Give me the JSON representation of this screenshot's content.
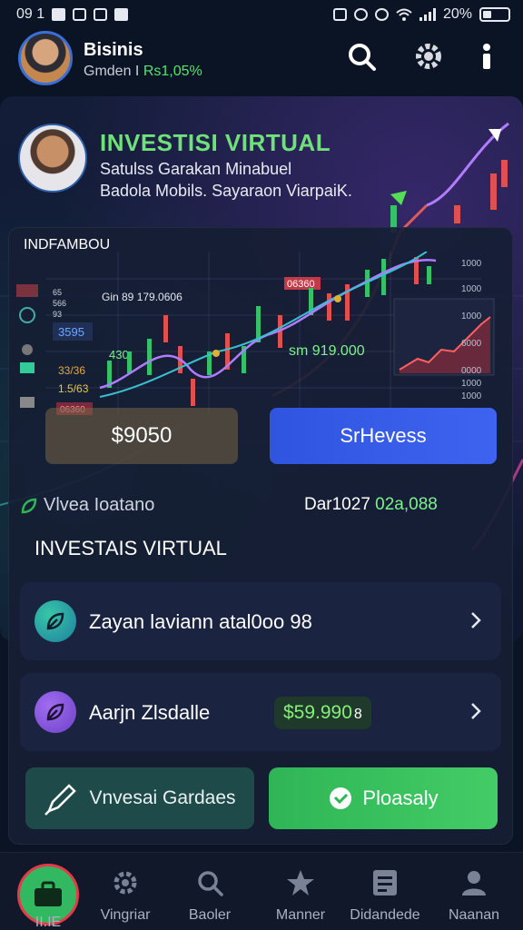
{
  "status_bar": {
    "time": "09 1",
    "battery": "20%"
  },
  "header": {
    "title": "Bisinis",
    "subtitle_prefix": "Gmden I",
    "subtitle_value": "Rs1,05%"
  },
  "hero": {
    "title": "INVESTISI VIRTUAL",
    "line1": "Satulss Garakan Minabuel",
    "line2": "Badola Mobils. Sayaraon ViarpaiK."
  },
  "panel": {
    "label": "INDFAMBOU",
    "chart_labels": {
      "price_tag": "Gin 89 179.0606",
      "value_tag": "sm 919.000",
      "high_tag": "06360",
      "side_tags": [
        "3595",
        "430",
        "33/36",
        "1.5/63",
        "06360"
      ],
      "left_codes": [
        "65",
        "566",
        "93"
      ],
      "right_ticks": [
        "1000",
        "1000",
        "1000",
        "6000",
        "0000",
        "1000",
        "1000"
      ]
    },
    "button_left": "$9050",
    "button_right": "SrHevess",
    "stat_left": "Vlvea Ioatano",
    "stat_right_prefix": "Dar1027",
    "stat_right_value": "02a,088",
    "section_title": "INVESTAIS VIRTUAL",
    "items": [
      {
        "label": "Zayan laviann atal0oo 98"
      },
      {
        "label": "Aarjn Zlsdalle",
        "badge": "$59.990",
        "badge_suffix": "8"
      }
    ],
    "bottom_left": "Vnvesai Gardaes",
    "bottom_right": "Ploasaly"
  },
  "nav": {
    "items": [
      {
        "label": "II.IE"
      },
      {
        "label": "Vingriar"
      },
      {
        "label": "Baoler"
      },
      {
        "label": "Manner"
      },
      {
        "label": "Didandede"
      },
      {
        "label": "Naanan"
      }
    ]
  },
  "colors": {
    "background": "#0b1424",
    "accent_green": "#54e36b",
    "accent_blue": "#2f55e0",
    "panel": "#1a2340"
  }
}
